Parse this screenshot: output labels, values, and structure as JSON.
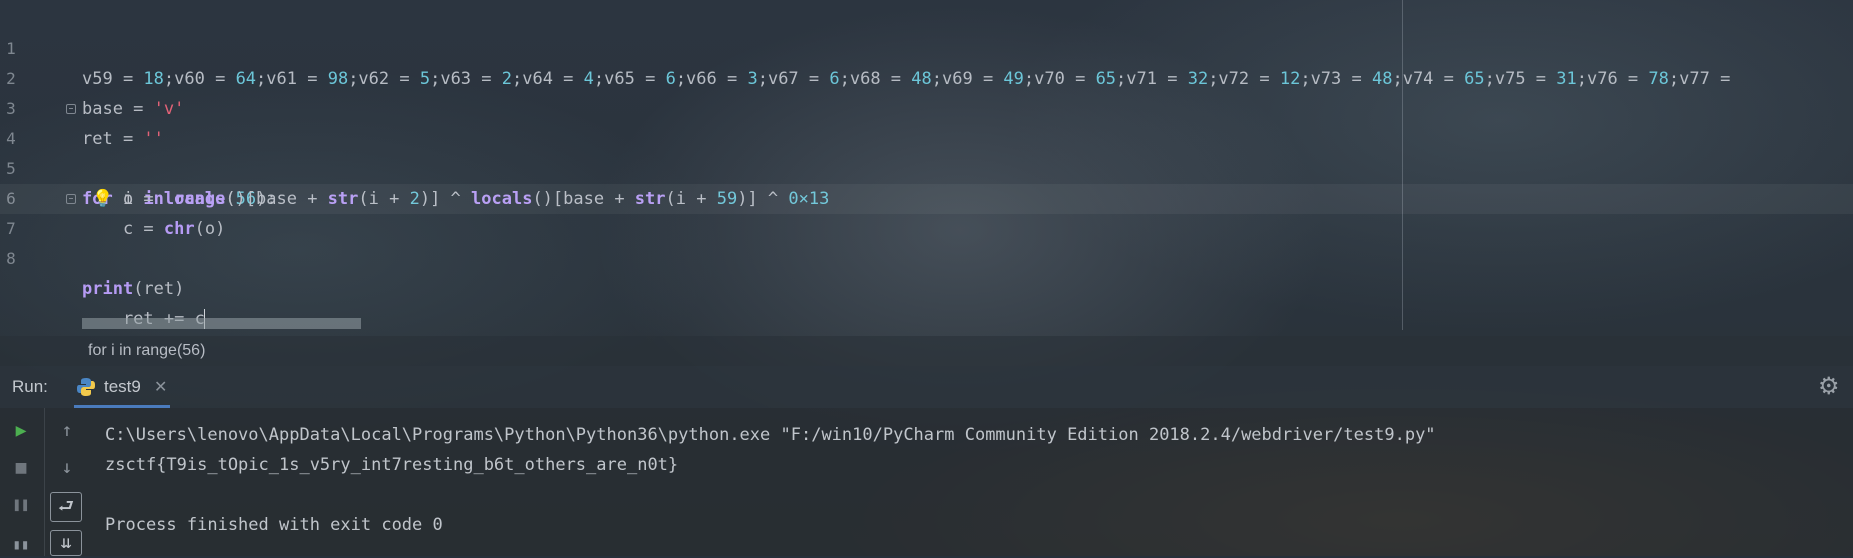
{
  "editor": {
    "lines": [
      {
        "num": "1",
        "text": "v59 = 18;v60 = 64;v61 = 98;v62 = 5;v63 = 2;v64 = 4;v65 = 6;v66 = 3;v67 = 6;v68 = 48;v69 = 49;v70 = 65;v71 = 32;v72 = 12;v73 = 48;v74 = 65;v75 = 31;v76 = 78;v77 ="
      },
      {
        "num": "2",
        "text": "base = 'v'"
      },
      {
        "num": "3",
        "text": "ret = ''"
      },
      {
        "num": "4",
        "text": "for i in range(56):"
      },
      {
        "num": "5",
        "text": "    o = locals()[base + str(i + 2)] ^ locals()[base + str(i + 59)] ^ 0×13"
      },
      {
        "num": "6",
        "text": "    c = chr(o)"
      },
      {
        "num": "7",
        "text": "    ret += c"
      },
      {
        "num": "8",
        "text": "print(ret)"
      }
    ],
    "current_line": 7,
    "bulb_icon": "lightbulb-icon",
    "fold_icon": "fold-marker-icon"
  },
  "breadcrumb": "for i in range(56)",
  "run": {
    "label": "Run:",
    "tab_label": "test9",
    "tab_icon": "python-icon",
    "close_icon": "close-icon",
    "settings_icon": "gear-icon"
  },
  "console": {
    "command": "C:\\Users\\lenovo\\AppData\\Local\\Programs\\Python\\Python36\\python.exe \"F:/win10/PyCharm Community Edition 2018.2.4/webdriver/test9.py\"",
    "output": "zsctf{T9is_tOpic_1s_v5ry_int7resting_b6t_others_are_n0t}",
    "status": "Process finished with exit code 0"
  },
  "colors": {
    "keyword": "#b69bf4",
    "number": "#6cc6d8",
    "string": "#e16277",
    "run_green": "#4caf50"
  }
}
